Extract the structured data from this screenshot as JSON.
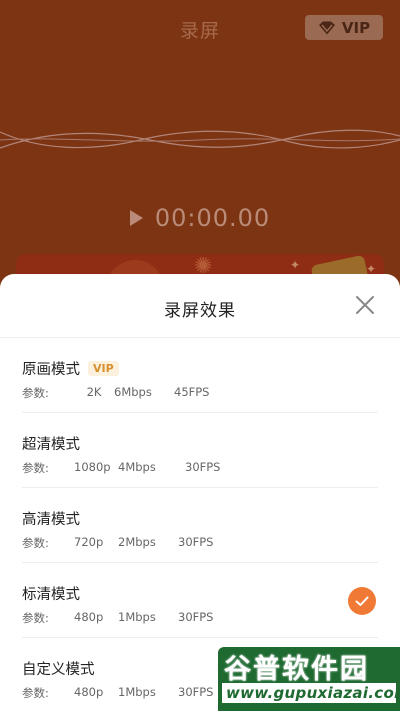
{
  "header": {
    "title": "录屏",
    "vip_label": "VIP",
    "vip_icon": "diamond-icon"
  },
  "player": {
    "play_icon": "play-icon",
    "time": "00:00.00"
  },
  "sheet": {
    "title": "录屏效果",
    "close_icon": "close-icon",
    "options": [
      {
        "name": "原画模式",
        "vip": "VIP",
        "params_label": "参数:",
        "resolution": "2K",
        "bitrate": "6Mbps",
        "fps": "45FPS",
        "selected": false
      },
      {
        "name": "超清模式",
        "vip": "",
        "params_label": "参数:",
        "resolution": "1080p",
        "bitrate": "4Mbps",
        "fps": "30FPS",
        "selected": false
      },
      {
        "name": "高清模式",
        "vip": "",
        "params_label": "参数:",
        "resolution": "720p",
        "bitrate": "2Mbps",
        "fps": "30FPS",
        "selected": false
      },
      {
        "name": "标清模式",
        "vip": "",
        "params_label": "参数:",
        "resolution": "480p",
        "bitrate": "1Mbps",
        "fps": "30FPS",
        "selected": true
      },
      {
        "name": "自定义模式",
        "vip": "",
        "params_label": "参数:",
        "resolution": "480p",
        "bitrate": "1Mbps",
        "fps": "30FPS",
        "selected": false
      }
    ]
  },
  "watermark": {
    "cn_text": "谷普软件园",
    "url": "www.gupuxiazai.com"
  },
  "colors": {
    "background": "#7c3412",
    "accent": "#f07a35",
    "vip_text": "#d7902d",
    "watermark_green": "#1f6a31"
  }
}
